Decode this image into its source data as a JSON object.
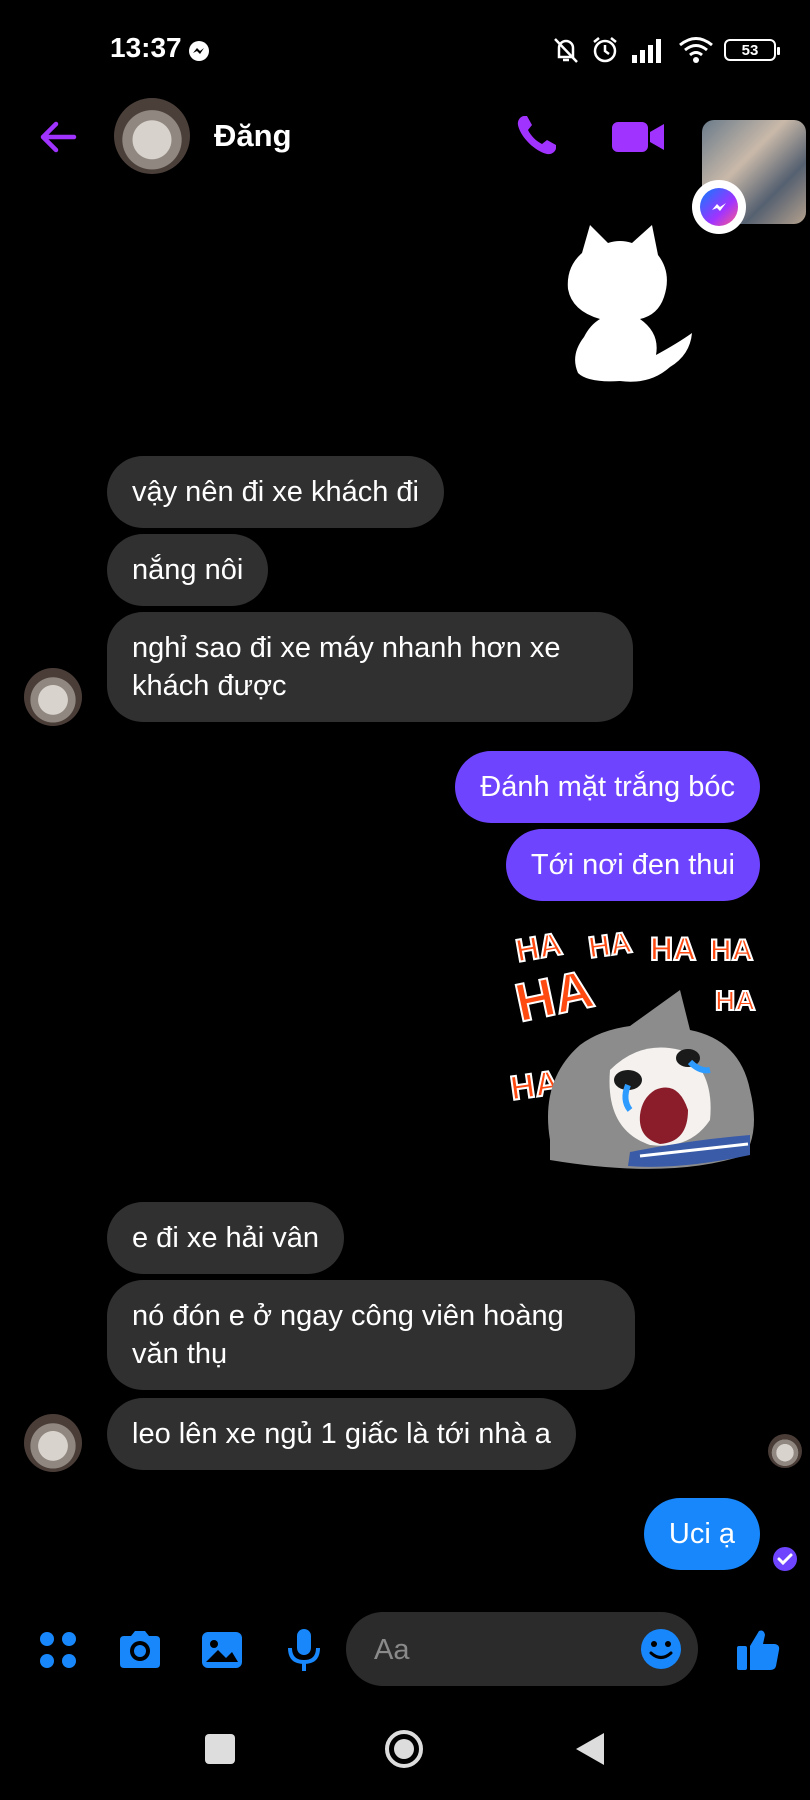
{
  "status_bar": {
    "time": "13:37",
    "battery": "53",
    "icons": [
      "messenger-icon",
      "mute-icon",
      "alarm-icon",
      "signal-icon",
      "wifi-icon",
      "battery-icon"
    ]
  },
  "header": {
    "contact_name": "Đăng",
    "icons": [
      "back-arrow-icon",
      "phone-icon",
      "video-camera-icon"
    ]
  },
  "messages": [
    {
      "side": "in",
      "text": "vậy nên đi xe khách đi"
    },
    {
      "side": "in",
      "text": "nắng nôi"
    },
    {
      "side": "in",
      "text_lines": [
        "nghỉ sao đi xe máy nhanh hơn xe",
        "khách được"
      ]
    },
    {
      "side": "out",
      "text": "Đánh mặt trắng bóc"
    },
    {
      "side": "out",
      "text": "Tới nơi đen thui"
    },
    {
      "side": "out",
      "type": "sticker",
      "sticker": "haha-cat-sticker"
    },
    {
      "side": "in",
      "text": "e đi xe hải vân"
    },
    {
      "side": "in",
      "text_lines": [
        "nó đón e ở ngay công viên hoàng",
        "văn thụ"
      ]
    },
    {
      "side": "in",
      "text": "leo lên xe ngủ 1 giấc là tới nhà a"
    },
    {
      "side": "out",
      "text": "Uci ạ"
    }
  ],
  "stickers": {
    "top": "white-cat-sticker",
    "haha_text": "HA"
  },
  "composer": {
    "placeholder": "Aa",
    "tools": [
      "menu-icon",
      "camera-icon",
      "image-icon",
      "microphone-icon",
      "emoji-icon",
      "thumbs-up-icon"
    ]
  },
  "colors": {
    "accent_purple": "#a033ff",
    "outgoing_bubble": "#6e44ff",
    "outgoing_bubble_latest": "#1787fb",
    "incoming_bubble": "#303030",
    "tool_blue": "#1787fb"
  }
}
